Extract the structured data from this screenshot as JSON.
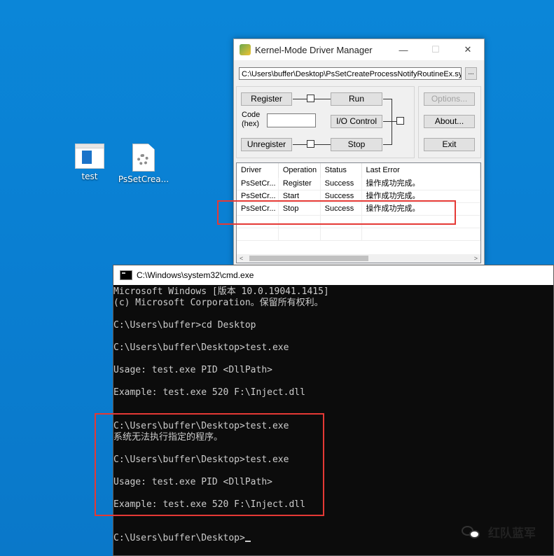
{
  "desktop": {
    "icons": [
      {
        "label": "test"
      },
      {
        "label": "PsSetCrea..."
      }
    ]
  },
  "driver_manager": {
    "title": "Kernel-Mode Driver Manager",
    "window_buttons": {
      "minimize": "—",
      "maximize": "☐",
      "close": "✕"
    },
    "path": "C:\\Users\\buffer\\Desktop\\PsSetCreateProcessNotifyRoutineEx.sys",
    "browse_label": "...",
    "buttons": {
      "register": "Register",
      "run": "Run",
      "io_control": "I/O Control",
      "unregister": "Unregister",
      "stop": "Stop",
      "options": "Options...",
      "about": "About...",
      "exit": "Exit"
    },
    "code_label": "Code\n(hex)",
    "code_value": "",
    "list": {
      "headers": [
        "Driver",
        "Operation",
        "Status",
        "Last Error"
      ],
      "rows": [
        {
          "driver": "PsSetCr...",
          "operation": "Register",
          "status": "Success",
          "error": "操作成功完成。"
        },
        {
          "driver": "PsSetCr...",
          "operation": "Start",
          "status": "Success",
          "error": "操作成功完成。"
        },
        {
          "driver": "PsSetCr...",
          "operation": "Stop",
          "status": "Success",
          "error": "操作成功完成。"
        }
      ]
    }
  },
  "cmd": {
    "title": "C:\\Windows\\system32\\cmd.exe",
    "lines": [
      "Microsoft Windows [版本 10.0.19041.1415]",
      "(c) Microsoft Corporation。保留所有权利。",
      "",
      "C:\\Users\\buffer>cd Desktop",
      "",
      "C:\\Users\\buffer\\Desktop>test.exe",
      "",
      "Usage: test.exe PID <DllPath>",
      "",
      "Example: test.exe 520 F:\\Inject.dll",
      "",
      "",
      "C:\\Users\\buffer\\Desktop>test.exe",
      "系统无法执行指定的程序。",
      "",
      "C:\\Users\\buffer\\Desktop>test.exe",
      "",
      "Usage: test.exe PID <DllPath>",
      "",
      "Example: test.exe 520 F:\\Inject.dll",
      "",
      "",
      "C:\\Users\\buffer\\Desktop>"
    ]
  },
  "watermark": {
    "text": "红队蓝军"
  },
  "colors": {
    "highlight_box": "#e53935",
    "desktop_blue": "#0a7fd2",
    "console_bg": "#0c0c0c"
  }
}
